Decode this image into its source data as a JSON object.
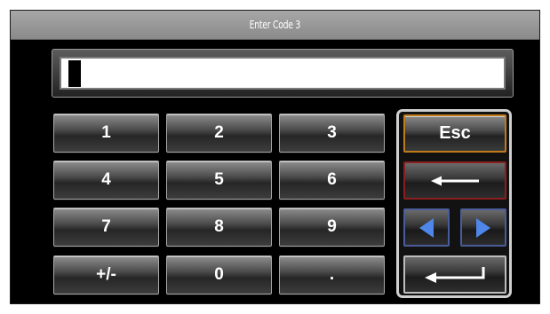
{
  "header": {
    "title": "Enter Code 3"
  },
  "input": {
    "value": ""
  },
  "keypad": {
    "keys": [
      "1",
      "2",
      "3",
      "4",
      "5",
      "6",
      "7",
      "8",
      "9",
      "+/-",
      "0",
      "."
    ]
  },
  "side_keys": {
    "esc_label": "Esc",
    "backspace_icon": "backspace-arrow-icon",
    "left_icon": "triangle-left-icon",
    "right_icon": "triangle-right-icon",
    "enter_icon": "enter-return-icon"
  },
  "colors": {
    "esc_border": "#c07a1a",
    "backspace_border": "#8a1e1e",
    "arrow_border": "#4a5b9a",
    "arrow_fill": "#4f86ea"
  }
}
